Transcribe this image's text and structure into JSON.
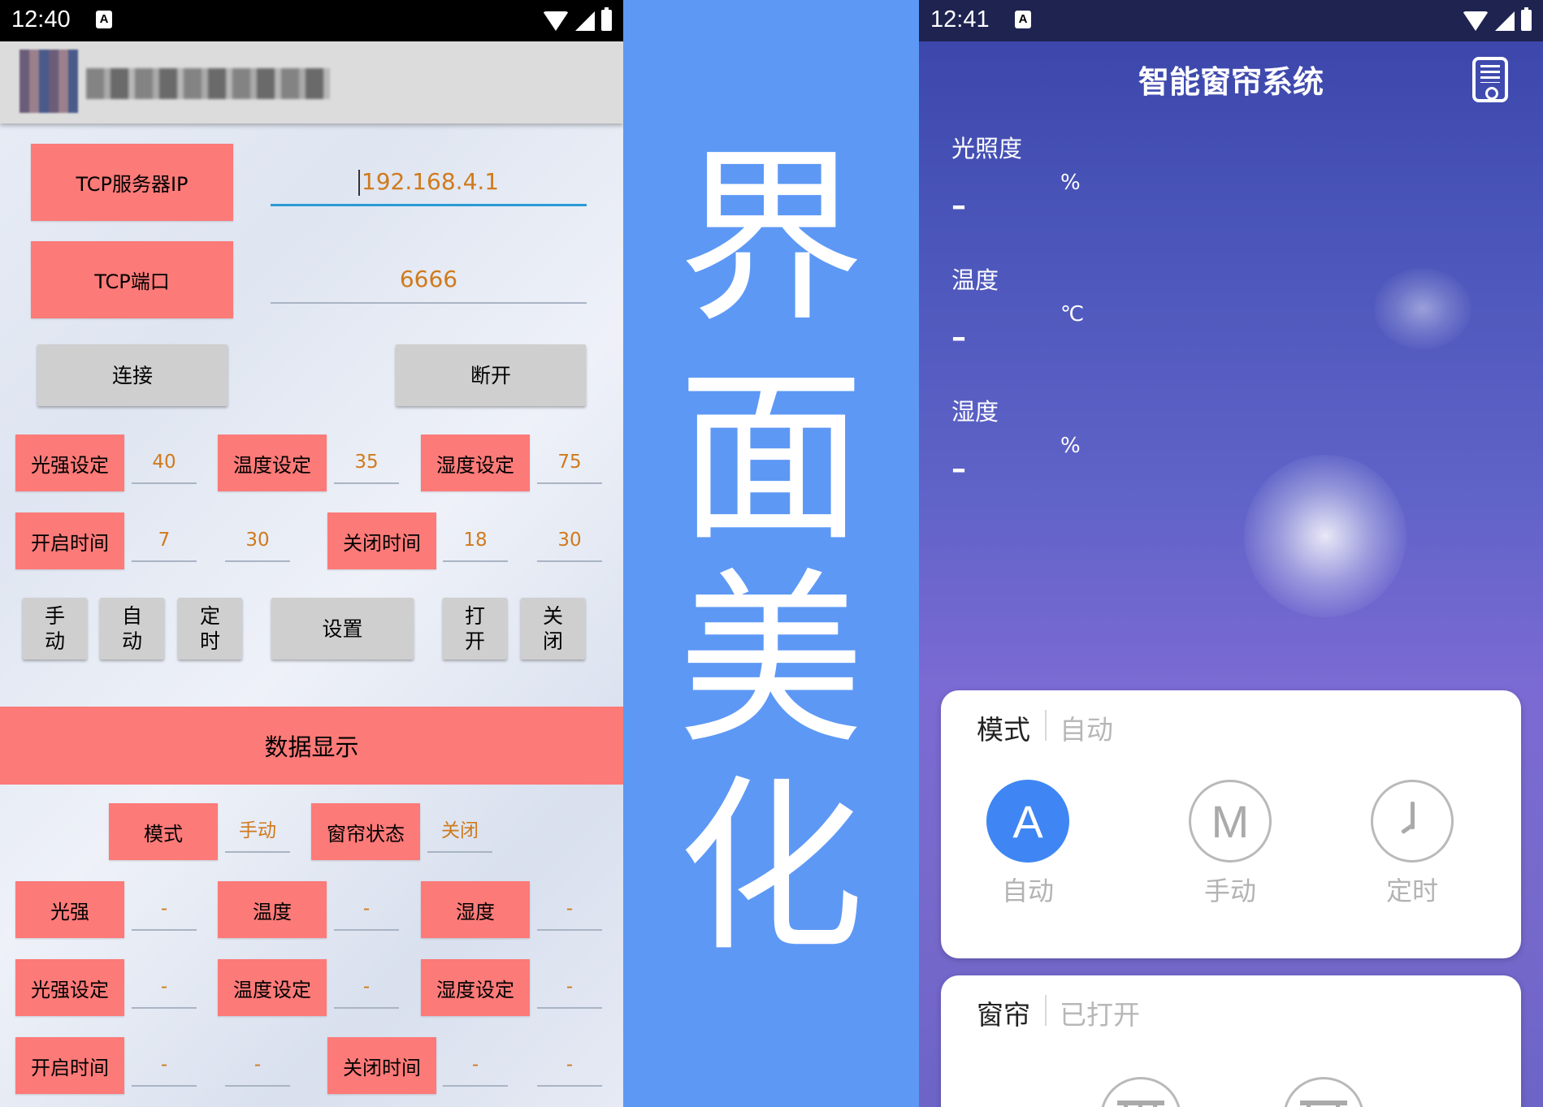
{
  "left_phone": {
    "status_time": "12:40",
    "status_badge": "A",
    "server_ip_label": "TCP服务器IP",
    "server_ip_value": "192.168.4.1",
    "port_label": "TCP端口",
    "port_value": "6666",
    "connect_label": "连接",
    "disconnect_label": "断开",
    "settings_row": [
      {
        "label": "光强设定",
        "value": "40"
      },
      {
        "label": "温度设定",
        "value": "35"
      },
      {
        "label": "湿度设定",
        "value": "75"
      }
    ],
    "time_row": {
      "open_label": "开启时间",
      "open_hour": "7",
      "open_min": "30",
      "close_label": "关闭时间",
      "close_hour": "18",
      "close_min": "30"
    },
    "buttons": {
      "manual": "手\n动",
      "auto": "自\n动",
      "timer": "定\n时",
      "set": "设置",
      "open": "打\n开",
      "close": "关\n闭"
    },
    "data_header": "数据显示",
    "mode_label": "模式",
    "mode_value": "手动",
    "curtain_label": "窗帘状态",
    "curtain_value": "关闭",
    "display_row1": [
      {
        "label": "光强",
        "value": "-"
      },
      {
        "label": "温度",
        "value": "-"
      },
      {
        "label": "湿度",
        "value": "-"
      }
    ],
    "display_row2": [
      {
        "label": "光强设定",
        "value": "-"
      },
      {
        "label": "温度设定",
        "value": "-"
      },
      {
        "label": "湿度设定",
        "value": "-"
      }
    ],
    "display_row3": {
      "open_label": "开启时间",
      "open_hour": "-",
      "open_min": "-",
      "close_label": "关闭时间",
      "close_hour": "-",
      "close_min": "-"
    }
  },
  "banner": {
    "chars": [
      "界",
      "面",
      "美",
      "化"
    ],
    "color": "#5d98f5"
  },
  "right_phone": {
    "status_time": "12:41",
    "status_badge": "A",
    "title": "智能窗帘系统",
    "sensors": [
      {
        "label": "光照度",
        "unit": "%",
        "value": "–"
      },
      {
        "label": "温度",
        "unit": "℃",
        "value": "–"
      },
      {
        "label": "湿度",
        "unit": "%",
        "value": "–"
      }
    ],
    "mode_card": {
      "title": "模式",
      "status": "自动",
      "options": [
        {
          "symbol": "A",
          "label": "自动",
          "selected": true
        },
        {
          "symbol": "M",
          "label": "手动",
          "selected": false
        },
        {
          "symbol": "clock-icon",
          "label": "定时",
          "selected": false
        }
      ]
    },
    "curtain_card": {
      "title": "窗帘",
      "status": "已打开"
    },
    "accent_color": "#3f86f4"
  }
}
